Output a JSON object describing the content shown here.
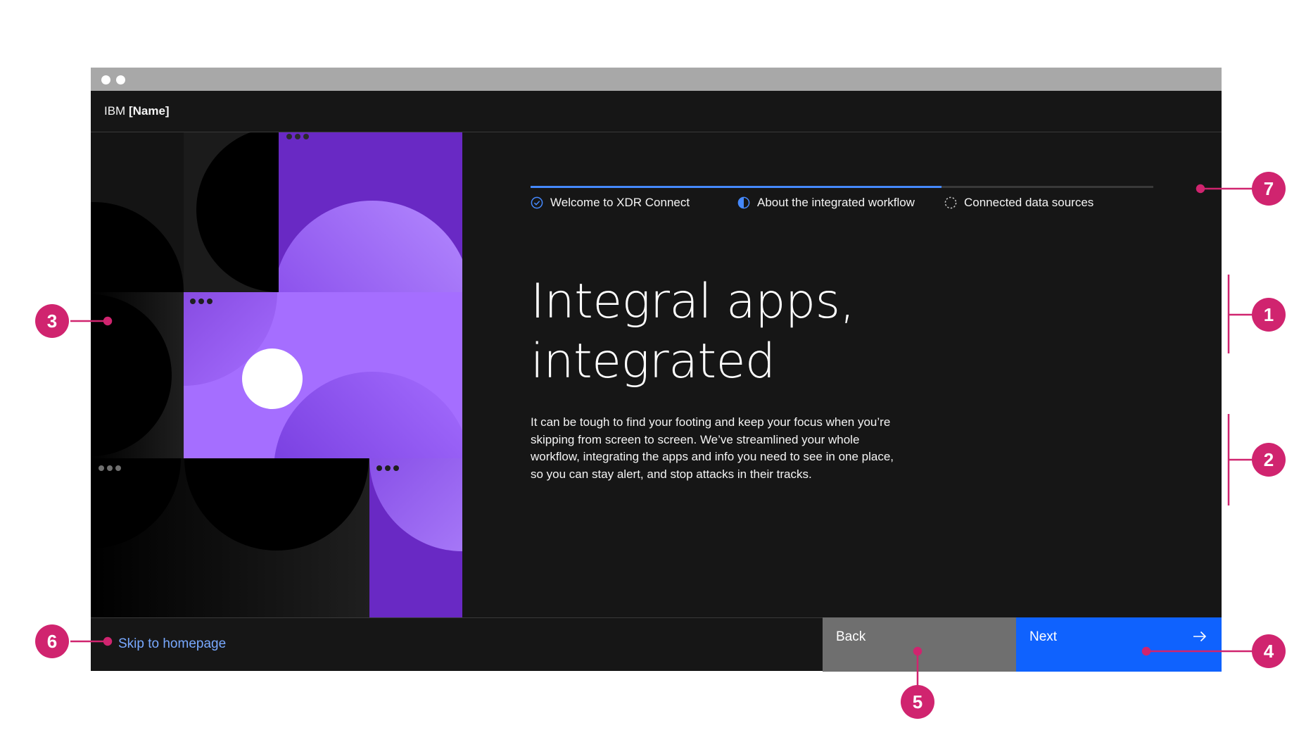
{
  "app": {
    "brand_prefix": "IBM",
    "brand_name": "[Name]"
  },
  "progress": {
    "completed_fraction": 0.66,
    "steps": [
      {
        "label": "Welcome to XDR Connect",
        "state": "complete",
        "icon": "checkmark-outline-icon"
      },
      {
        "label": "About the integrated workflow",
        "state": "current",
        "icon": "half-circle-icon"
      },
      {
        "label": "Connected data sources",
        "state": "incomplete",
        "icon": "dashed-circle-icon"
      }
    ]
  },
  "main": {
    "title_line1": "Integral apps,",
    "title_line2": "integrated",
    "body": "It can be tough to find your footing and keep your focus when you’re skipping from screen to screen. We’ve streamlined your whole workflow, integrating the apps and info you need to see in one place, so you can stay alert, and stop attacks in their tracks."
  },
  "footer": {
    "skip_label": "Skip to homepage",
    "back_label": "Back",
    "next_label": "Next",
    "next_icon": "arrow-right-icon"
  },
  "callouts": [
    "1",
    "2",
    "3",
    "4",
    "5",
    "6",
    "7"
  ],
  "colors": {
    "background": "#161616",
    "primary_button": "#0f62fe",
    "secondary_button": "#6f6f6f",
    "link": "#78a9ff",
    "progress_active": "#4589ff",
    "annotation": "#d0246f",
    "illustration_purple": "#a56eff",
    "illustration_violet": "#6929c4"
  }
}
